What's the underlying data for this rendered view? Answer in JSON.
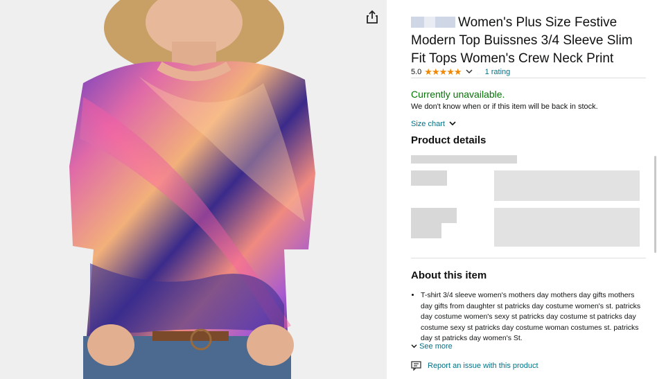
{
  "product": {
    "title": "Women's Plus Size Festive Modern Top Buissnes 3/4 Sleeve Slim Fit Tops Women's Crew Neck Print",
    "rating_value": "5.0",
    "stars": "★★★★★",
    "rating_count": "1 rating",
    "availability": "Currently unavailable.",
    "availability_note": "We don't know when or if this item will be back in stock.",
    "size_chart_label": "Size chart"
  },
  "sections": {
    "product_details_heading": "Product details",
    "about_heading": "About this item",
    "about_bullet": "T-shirt 3/4 sleeve women's mothers day mothers day gifts mothers day gifts from daughter st patricks day costume women's st. patricks day costume women's sexy st patricks day costume st patricks day costume sexy st patricks day costume woman costumes st. patricks day st patricks day women's St.",
    "see_more": "See more",
    "report_issue": "Report an issue with this product"
  },
  "icons": {
    "share": "share-icon",
    "chevron": "chevron-down-icon",
    "report": "report-icon"
  },
  "colors": {
    "link": "#007185",
    "available_green": "#007600",
    "star": "#f08804"
  }
}
